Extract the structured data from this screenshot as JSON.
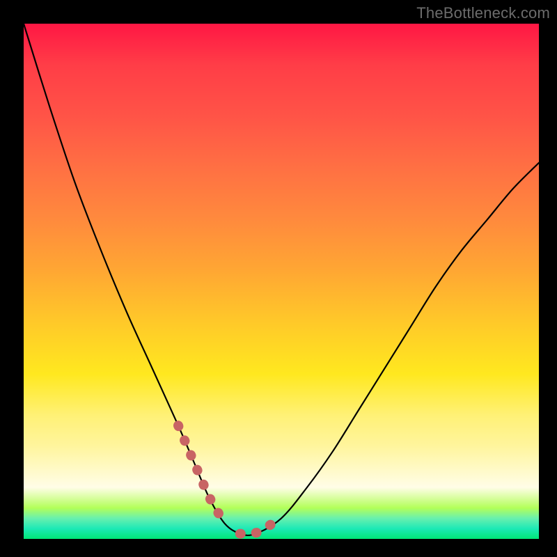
{
  "watermark": "TheBottleneck.com",
  "colors": {
    "frame_bg": "#000000",
    "curve_stroke": "#000000",
    "marker_stroke": "#c86464",
    "watermark": "#6c6c6c"
  },
  "chart_data": {
    "type": "line",
    "title": "",
    "xlabel": "",
    "ylabel": "",
    "xlim": [
      0,
      100
    ],
    "ylim": [
      0,
      100
    ],
    "grid": false,
    "legend": false,
    "series": [
      {
        "name": "bottleneck-curve",
        "x": [
          0,
          5,
          10,
          15,
          20,
          25,
          30,
          33,
          36,
          39,
          42,
          45,
          50,
          55,
          60,
          65,
          70,
          75,
          80,
          85,
          90,
          95,
          100
        ],
        "y": [
          100,
          84,
          69,
          56,
          44,
          33,
          22,
          15,
          8,
          3,
          1,
          1,
          4,
          10,
          17,
          25,
          33,
          41,
          49,
          56,
          62,
          68,
          73
        ]
      }
    ],
    "markers": {
      "name": "highlight-segments",
      "ranges_x": [
        [
          30,
          39
        ],
        [
          42,
          50
        ]
      ]
    }
  }
}
